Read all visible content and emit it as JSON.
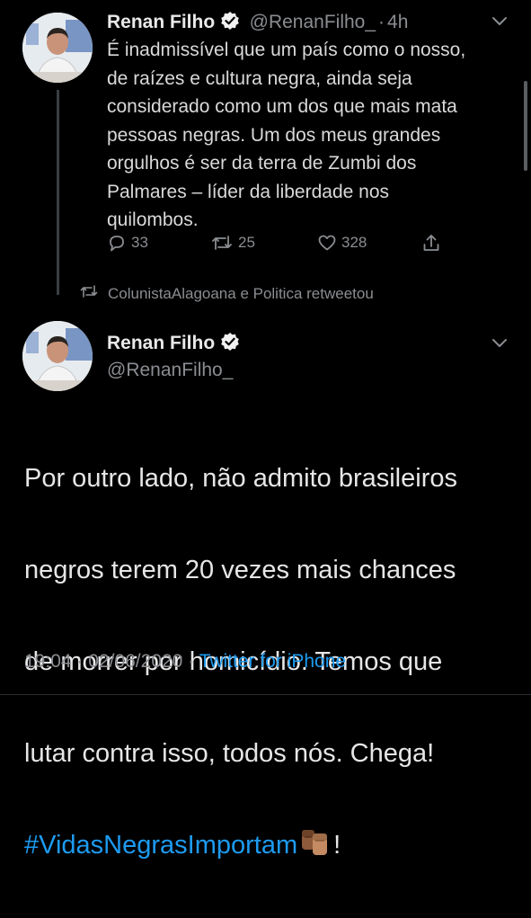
{
  "tweet1": {
    "name": "Renan Filho",
    "handle": "@RenanFilho_",
    "separator": "·",
    "time": "4h",
    "text": "É inadmissível que um país como o nosso,\nde raízes e cultura negra, ainda seja\nconsiderado como um dos que mais mata\npessoas negras. Um dos meus grandes\norgulhos é ser da terra de Zumbi dos\nPalmares – líder da liberdade nos\nquilombos.",
    "replies": "33",
    "retweets": "25",
    "likes": "328"
  },
  "retweet_notice": {
    "text": "ColunistaAlagoana e Politica retweetou"
  },
  "tweet2": {
    "name": "Renan Filho",
    "handle": "@RenanFilho_",
    "text_lines": [
      "Por outro lado, não admito brasileiros",
      "negros terem 20 vezes mais chances",
      "de morrer por homicídio. Temos que",
      "lutar contra isso, todos nós. Chega!"
    ],
    "hashtag": "#VidasNegrasImportam",
    "emoji": "✊🏾",
    "trailing": "!",
    "time": "19:04",
    "dot": "·",
    "date": "02/06/2020",
    "dot2": "·",
    "client": "Twitter for iPhone"
  },
  "colors": {
    "background": "#000000",
    "link": "#1d9bf0",
    "secondary_text": "#8a8d91"
  }
}
